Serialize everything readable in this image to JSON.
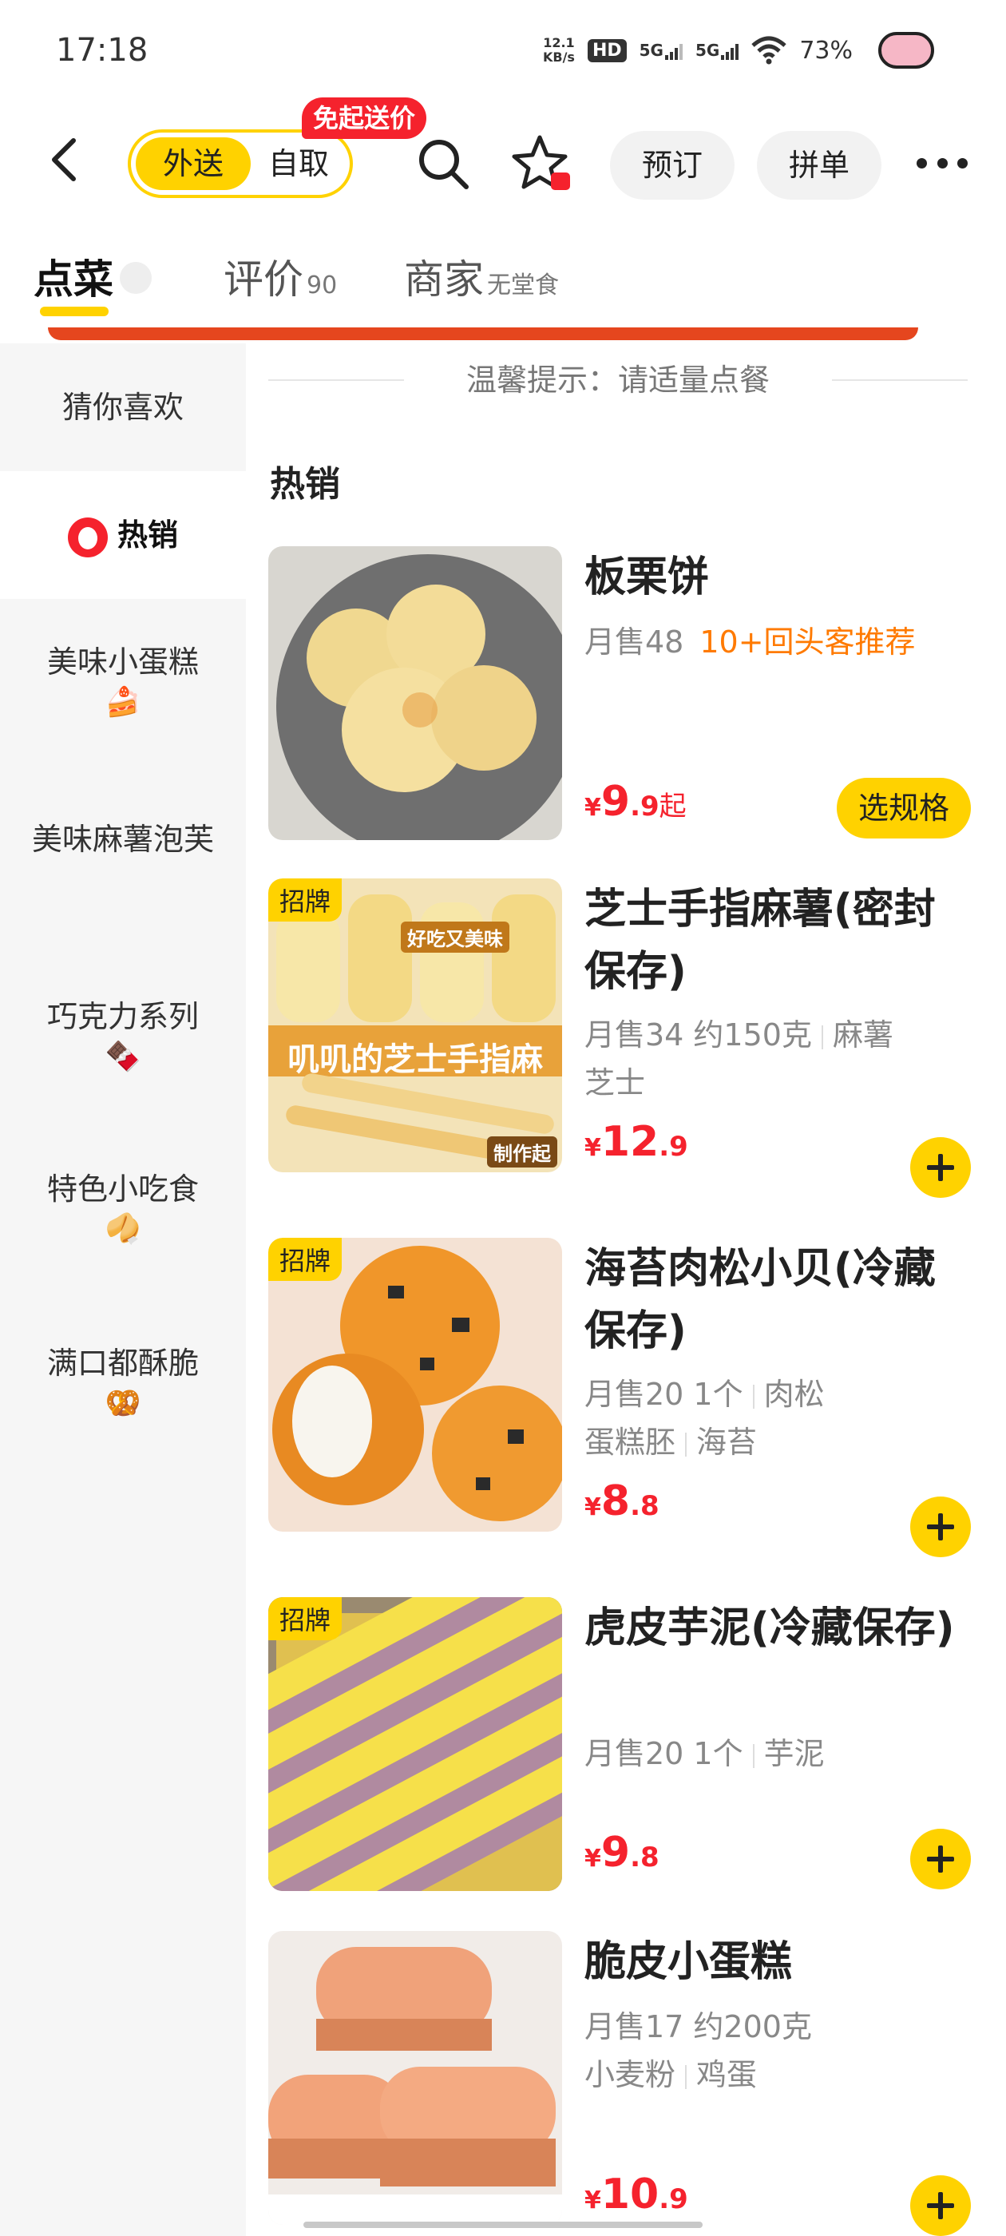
{
  "status_bar": {
    "time": "17:18",
    "speed_value": "12.1",
    "speed_unit": "KB/s",
    "hd": "HD",
    "net1": "5G",
    "net2": "5G",
    "battery": "73%"
  },
  "header": {
    "mode_delivery": "外送",
    "mode_pickup": "自取",
    "free_badge": "免起送价",
    "reserve_label": "预订",
    "group_label": "拼单"
  },
  "tabs": [
    {
      "label": "点菜",
      "sub": ""
    },
    {
      "label": "评价",
      "sub": "90"
    },
    {
      "label": "商家",
      "sub": "无堂食"
    }
  ],
  "tip": "温馨提示：请适量点餐",
  "sidebar": {
    "items": [
      {
        "label": "猜你喜欢",
        "emoji": ""
      },
      {
        "label": "热销",
        "emoji": ""
      },
      {
        "label": "美味小蛋糕",
        "emoji": "🍰"
      },
      {
        "label": "美味麻薯泡芙",
        "emoji": ""
      },
      {
        "label": "巧克力系列",
        "emoji": "🍫"
      },
      {
        "label": "特色小吃食",
        "emoji": "🥠"
      },
      {
        "label": "满口都酥脆",
        "emoji": "🥨"
      }
    ]
  },
  "section_title": "热销",
  "items": [
    {
      "name": "板栗饼",
      "sales": "月售48",
      "hot": "10+回头客推荐",
      "price_int": "9",
      "price_dec": ".9",
      "price_suffix": "起",
      "button": "选规格"
    },
    {
      "name": "芝士手指麻薯(密封保存)",
      "tag": "招牌",
      "meta1": "月售34  约150克",
      "meta1b": "麻薯",
      "meta2": "芝士",
      "price_int": "12",
      "price_dec": ".9",
      "thumb_text1": "好吃又美味",
      "thumb_text2": "叽叽的芝士手指麻",
      "thumb_text3": "制作起"
    },
    {
      "name": "海苔肉松小贝(冷藏保存)",
      "tag": "招牌",
      "meta1": "月售20  1个",
      "meta1b": "肉松",
      "meta2": "蛋糕胚",
      "meta2b": "海苔",
      "price_int": "8",
      "price_dec": ".8"
    },
    {
      "name": "虎皮芋泥(冷藏保存)",
      "tag": "招牌",
      "meta1": "月售20  1个",
      "meta1b": "芋泥",
      "price_int": "9",
      "price_dec": ".8"
    },
    {
      "name": "脆皮小蛋糕",
      "meta1": "月售17  约200克",
      "meta2": "小麦粉",
      "meta2b": "鸡蛋",
      "price_int": "10",
      "price_dec": ".9"
    }
  ],
  "currency": "¥",
  "colors": {
    "accent": "#ffd200",
    "price": "#f5222d",
    "hot": "#ff7a00"
  }
}
